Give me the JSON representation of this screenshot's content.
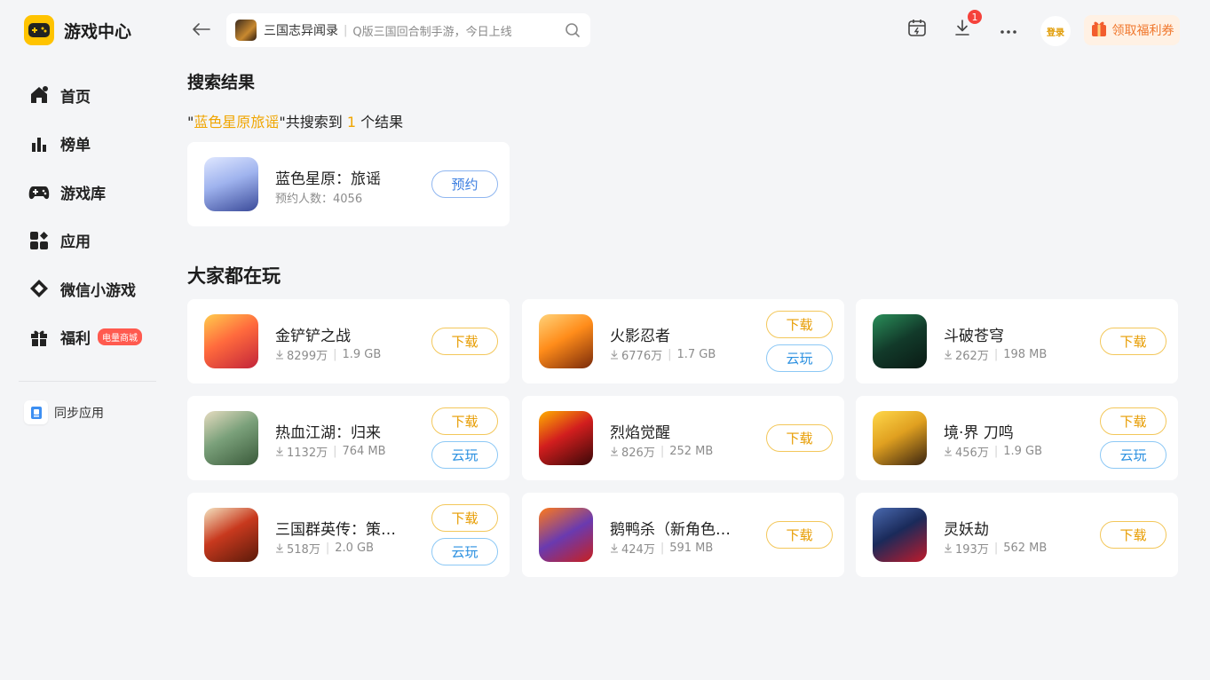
{
  "app": {
    "title": "游戏中心"
  },
  "colors": {
    "accent": "#ffc300",
    "highlight": "#f0a500",
    "download": "#e79c00",
    "cloud": "#2b90e0",
    "badge": "#f5423b"
  },
  "sidebar": {
    "items": [
      {
        "label": "首页",
        "icon": "home-icon"
      },
      {
        "label": "榜单",
        "icon": "chart-icon"
      },
      {
        "label": "游戏库",
        "icon": "gamepad-icon"
      },
      {
        "label": "应用",
        "icon": "apps-icon"
      },
      {
        "label": "微信小游戏",
        "icon": "wechat-game-icon"
      },
      {
        "label": "福利",
        "icon": "gift-icon",
        "badge": "电量商城"
      }
    ],
    "sync_label": "同步应用"
  },
  "search": {
    "query": "三国志异闻录",
    "hint": "Q版三国回合制手游，今日上线"
  },
  "topbar": {
    "download_badge": "1",
    "login_label": "登录",
    "coupon_label": "领取福利券"
  },
  "results": {
    "title": "搜索结果",
    "quote_open": "\"",
    "keyword": "蓝色星原旅谣",
    "mid_text": "\"共搜索到 ",
    "count": "1",
    "suffix": " 个结果",
    "item": {
      "name": "蓝色星原：旅谣",
      "meta": "预约人数：4056",
      "button": "预约"
    }
  },
  "popular": {
    "title": "大家都在玩",
    "download_label": "下载",
    "cloud_label": "云玩",
    "games": [
      {
        "name": "金铲铲之战",
        "downloads": "8299万",
        "size": "1.9 GB",
        "cloud": false
      },
      {
        "name": "火影忍者",
        "downloads": "6776万",
        "size": "1.7 GB",
        "cloud": true
      },
      {
        "name": "斗破苍穹",
        "downloads": "262万",
        "size": "198 MB",
        "cloud": false
      },
      {
        "name": "热血江湖：归来",
        "downloads": "1132万",
        "size": "764 MB",
        "cloud": true
      },
      {
        "name": "烈焰觉醒",
        "downloads": "826万",
        "size": "252 MB",
        "cloud": false
      },
      {
        "name": "境·界 刀鸣",
        "downloads": "456万",
        "size": "1.9 GB",
        "cloud": true
      },
      {
        "name": "三国群英传：策定...",
        "downloads": "518万",
        "size": "2.0 GB",
        "cloud": true
      },
      {
        "name": "鹅鸭杀（新角色登...",
        "downloads": "424万",
        "size": "591 MB",
        "cloud": false
      },
      {
        "name": "灵妖劫",
        "downloads": "193万",
        "size": "562 MB",
        "cloud": false
      }
    ]
  }
}
